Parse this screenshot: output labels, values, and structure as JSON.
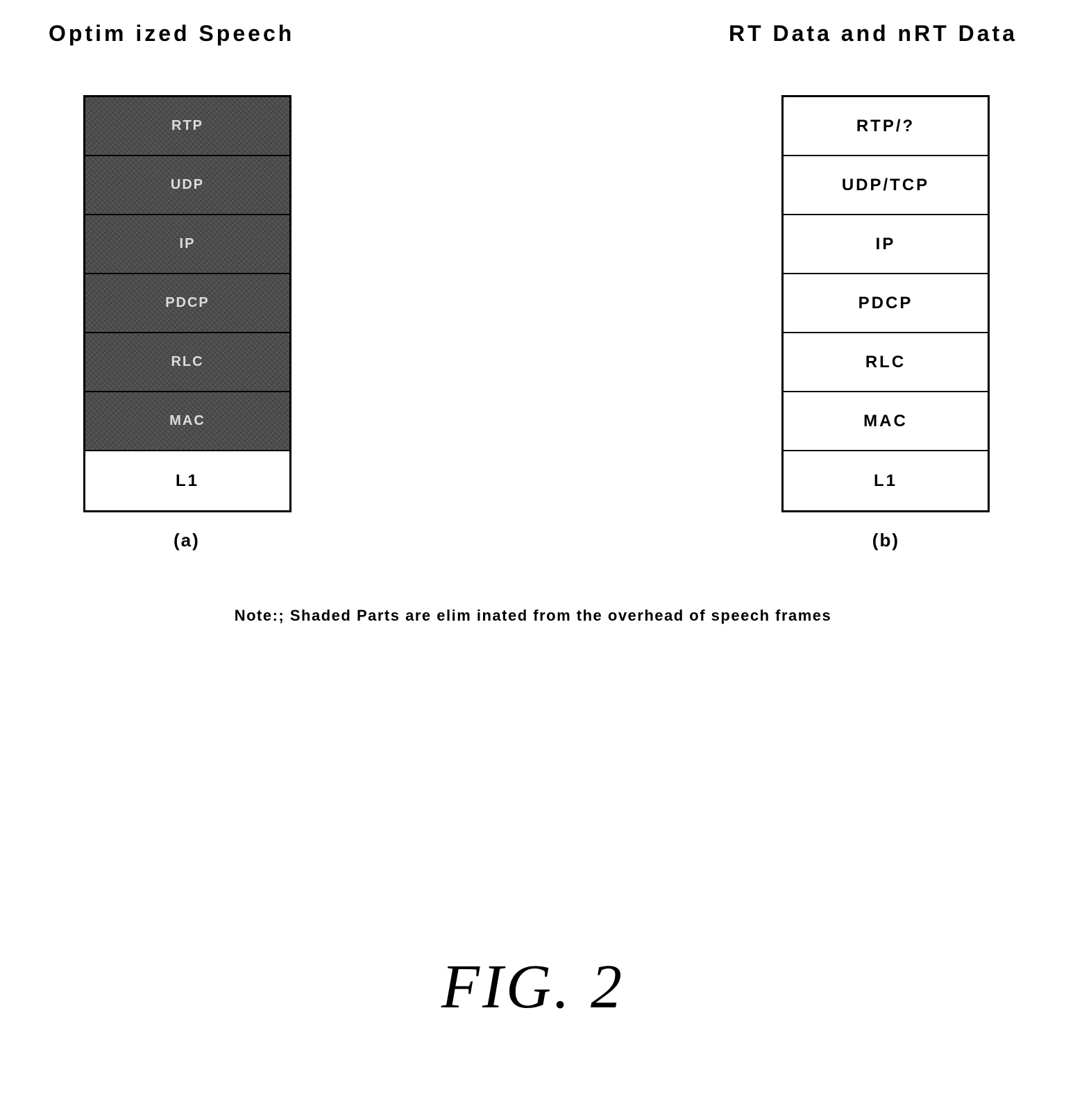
{
  "titles": {
    "left": "Optim ized Speech",
    "right": "RT Data and nRT Data"
  },
  "stack_a": {
    "layers": [
      "RTP",
      "UDP",
      "IP",
      "PDCP",
      "RLC",
      "MAC",
      "L1"
    ],
    "label": "(a)"
  },
  "stack_b": {
    "layers": [
      "RTP/?",
      "UDP/TCP",
      "IP",
      "PDCP",
      "RLC",
      "MAC",
      "L1"
    ],
    "label": "(b)"
  },
  "note": "Note:; Shaded Parts are elim inated from the overhead of speech frames",
  "figure_label": "FIG. 2"
}
